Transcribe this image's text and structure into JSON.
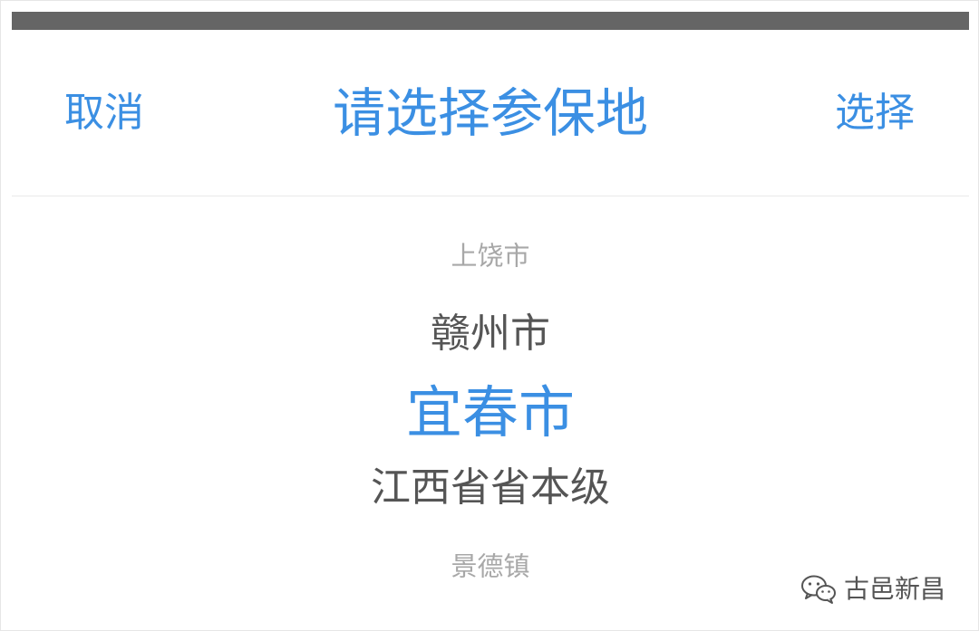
{
  "header": {
    "cancel_label": "取消",
    "title": "请选择参保地",
    "select_label": "选择"
  },
  "picker": {
    "options": [
      "上饶市",
      "赣州市",
      "宜春市",
      "江西省省本级",
      "景德镇"
    ],
    "selected": "宜春市"
  },
  "watermark": {
    "icon": "wechat-icon",
    "text": "古邑新昌"
  },
  "colors": {
    "accent": "#3b8fe3",
    "topbar": "#656565",
    "text_dark": "#555555",
    "text_faded": "#a8a8a8"
  }
}
